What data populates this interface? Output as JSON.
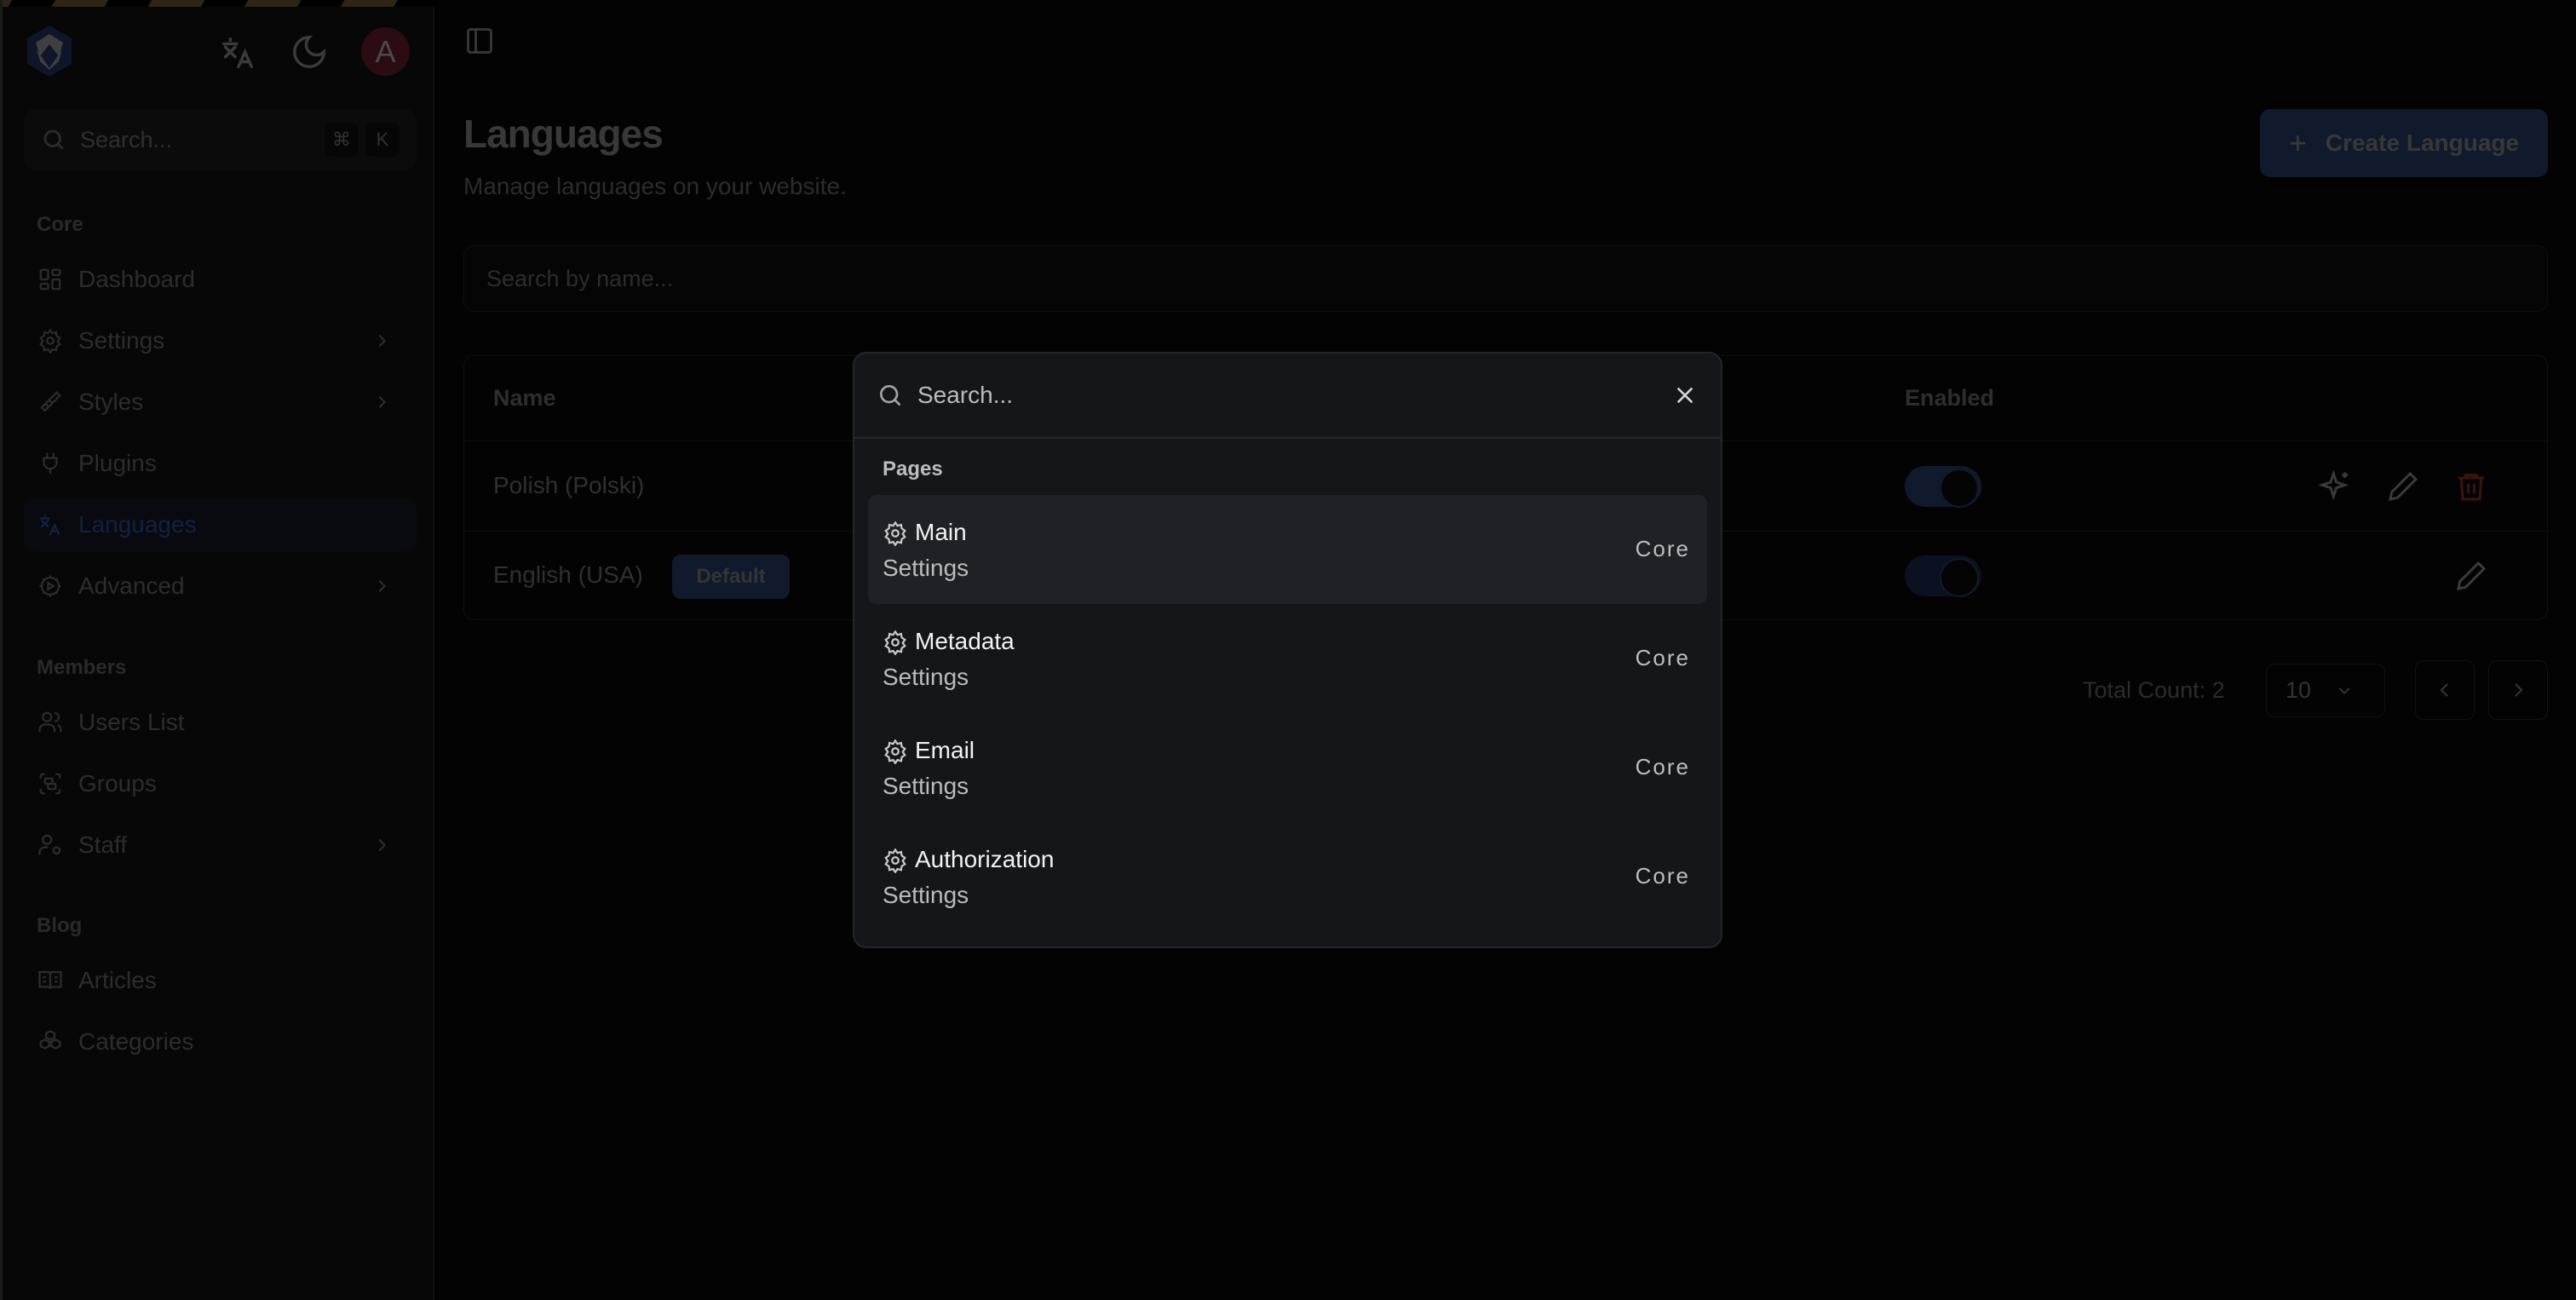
{
  "sidebar": {
    "search": {
      "placeholder": "Search...",
      "shortcut_keys": [
        "⌘",
        "K"
      ]
    },
    "avatar_initial": "A",
    "groups": [
      {
        "label": "Core",
        "items": [
          {
            "label": "Dashboard",
            "icon": "dashboard-icon",
            "has_children": false
          },
          {
            "label": "Settings",
            "icon": "settings-icon",
            "has_children": true
          },
          {
            "label": "Styles",
            "icon": "paintbrush-icon",
            "has_children": true
          },
          {
            "label": "Plugins",
            "icon": "plug-icon",
            "has_children": false
          },
          {
            "label": "Languages",
            "icon": "languages-icon",
            "has_children": false,
            "active": true
          },
          {
            "label": "Advanced",
            "icon": "cog-play-icon",
            "has_children": true
          }
        ]
      },
      {
        "label": "Members",
        "items": [
          {
            "label": "Users List",
            "icon": "users-icon",
            "has_children": false
          },
          {
            "label": "Groups",
            "icon": "group-icon",
            "has_children": false
          },
          {
            "label": "Staff",
            "icon": "user-cog-icon",
            "has_children": true
          }
        ]
      },
      {
        "label": "Blog",
        "items": [
          {
            "label": "Articles",
            "icon": "book-open-icon",
            "has_children": false
          },
          {
            "label": "Categories",
            "icon": "boxes-icon",
            "has_children": false
          }
        ]
      }
    ]
  },
  "header": {
    "title": "Languages",
    "subtitle": "Manage languages on your website.",
    "create_button": "Create Language"
  },
  "filter": {
    "placeholder": "Search by name..."
  },
  "table": {
    "columns": [
      "Name",
      "Enabled"
    ],
    "rows": [
      {
        "name": "Polish (Polski)",
        "badge": "",
        "enabled": true,
        "actions": [
          "sparkles",
          "edit",
          "delete"
        ]
      },
      {
        "name": "English (USA)",
        "badge": "Default",
        "enabled": true,
        "actions": [
          "edit"
        ]
      }
    ]
  },
  "pagination": {
    "total_label": "Total Count: 2",
    "per_page": "10"
  },
  "command_palette": {
    "search_placeholder": "Search...",
    "group_label": "Pages",
    "items": [
      {
        "title": "Main",
        "subtitle": "Settings",
        "tag": "Core",
        "selected": true
      },
      {
        "title": "Metadata",
        "subtitle": "Settings",
        "tag": "Core",
        "selected": false
      },
      {
        "title": "Email",
        "subtitle": "Settings",
        "tag": "Core",
        "selected": false
      },
      {
        "title": "Authorization",
        "subtitle": "Settings",
        "tag": "Core",
        "selected": false
      }
    ]
  },
  "colors": {
    "accent": "#1e3a8a",
    "danger": "#dc2626",
    "avatar": "#7f1d2d",
    "stripe": "#eab308"
  }
}
